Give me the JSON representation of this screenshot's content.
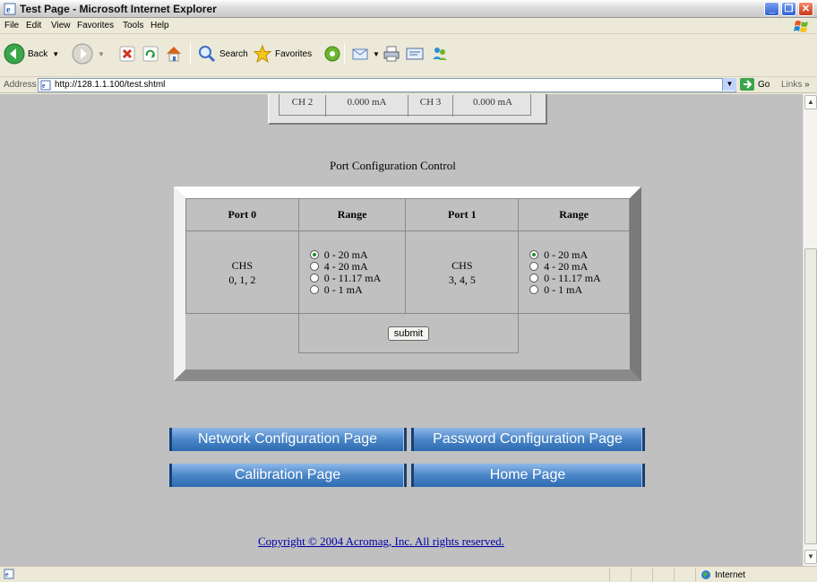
{
  "window": {
    "title": "Test Page - Microsoft Internet Explorer"
  },
  "menu": {
    "items": [
      {
        "label": "File",
        "key": "F"
      },
      {
        "label": "Edit",
        "key": "E"
      },
      {
        "label": "View",
        "key": "V"
      },
      {
        "label": "Favorites",
        "key": "a"
      },
      {
        "label": "Tools",
        "key": "T"
      },
      {
        "label": "Help",
        "key": "H"
      }
    ]
  },
  "toolbar": {
    "back_label": "Back",
    "search_label": "Search",
    "favorites_label": "Favorites"
  },
  "address": {
    "label": "Address",
    "url": "http://128.1.1.100/test.shtml",
    "go_label": "Go",
    "links_label": "Links"
  },
  "top_table": {
    "cells": [
      "CH 2",
      "0.000 mA",
      "CH 3",
      "0.000 mA"
    ]
  },
  "port_config": {
    "title": "Port Configuration Control",
    "headers": [
      "Port 0",
      "Range",
      "Port 1",
      "Range"
    ],
    "port0": {
      "line1": "CHS",
      "line2": "0, 1, 2"
    },
    "port1": {
      "line1": "CHS",
      "line2": "3, 4, 5"
    },
    "ranges": [
      "0 - 20 mA",
      "4 - 20 mA",
      "0 - 11.17 mA",
      "0 - 1 mA"
    ],
    "port0_selected": "0 - 20 mA",
    "port1_selected": "0 - 20 mA",
    "submit_label": "submit"
  },
  "nav": {
    "network": "Network Configuration Page",
    "password": "Password Configuration Page",
    "calibration": "Calibration Page",
    "home": "Home Page"
  },
  "footer": {
    "copyright": "Copyright © 2004 Acromag, Inc. All rights reserved."
  },
  "status": {
    "zone": "Internet"
  }
}
